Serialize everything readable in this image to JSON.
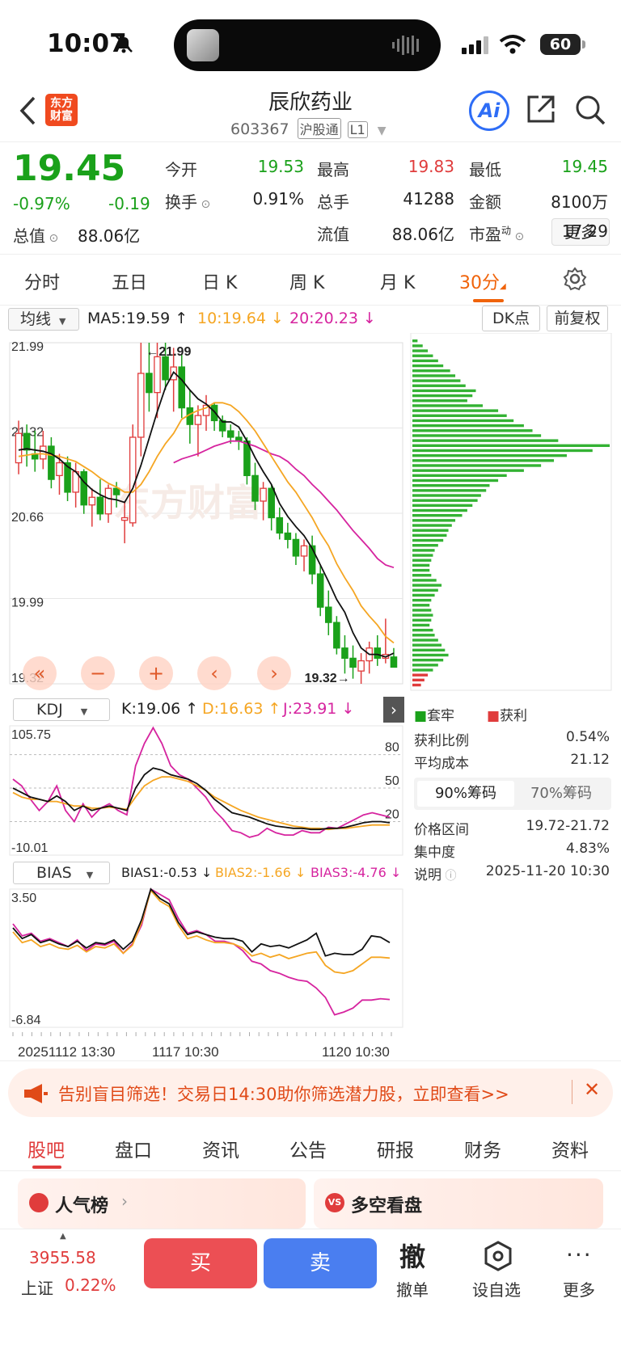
{
  "status": {
    "time": "10:07",
    "battery": "60"
  },
  "header": {
    "title": "辰欣药业",
    "code": "603367",
    "tag1": "沪股通",
    "tag2": "L1",
    "logo_line1": "东方",
    "logo_line2": "财富",
    "ai_label": "Ai"
  },
  "quote": {
    "price": "19.45",
    "change_pct": "-0.97%",
    "change": "-0.19",
    "rows": [
      [
        {
          "label": "今开",
          "value": "19.53",
          "color": "green"
        },
        {
          "label": "最高",
          "value": "19.83",
          "color": "red"
        },
        {
          "label": "最低",
          "value": "19.45",
          "color": "green"
        }
      ],
      [
        {
          "label": "换手",
          "value": "0.91%",
          "color": "none"
        },
        {
          "label": "总手",
          "value": "41288",
          "color": "none"
        },
        {
          "label": "金额",
          "value": "8100万",
          "color": "none"
        }
      ],
      [
        {
          "label": "流值",
          "value": "88.06亿",
          "color": "none"
        },
        {
          "label": "市盈",
          "value": "17.29",
          "color": "none"
        }
      ]
    ],
    "total_label": "总值",
    "total_value": "88.06亿",
    "pe_sup": "动",
    "more_label": "更多"
  },
  "tabs": [
    "分时",
    "五日",
    "日 K",
    "周 K",
    "月 K",
    "30分"
  ],
  "active_tab": "30分",
  "kchart": {
    "ma_select": "均线",
    "ma5": "MA5:19.59",
    "ma10": "10:19.64",
    "ma20": "20:20.23",
    "dk_label": "DK点",
    "adjust_label": "前复权",
    "price_ticks": [
      "21.99",
      "21.32",
      "20.66",
      "19.99",
      "19.32"
    ],
    "high_label": "21.99",
    "low_label": "19.32",
    "watermark": "东方财富",
    "colors": {
      "up": "#e03c3c",
      "down": "#1aa11a",
      "ma5": "#111111",
      "ma10": "#f5a623",
      "ma20": "#d6249f"
    }
  },
  "chart_data": {
    "type": "candlestick",
    "interval": "30分",
    "candles": [
      {
        "o": 21.05,
        "h": 21.38,
        "l": 20.96,
        "c": 21.28
      },
      {
        "o": 21.28,
        "h": 21.35,
        "l": 21.02,
        "c": 21.15
      },
      {
        "o": 21.12,
        "h": 21.3,
        "l": 20.98,
        "c": 21.08
      },
      {
        "o": 21.08,
        "h": 21.3,
        "l": 21.0,
        "c": 21.18
      },
      {
        "o": 21.18,
        "h": 21.25,
        "l": 20.85,
        "c": 20.92
      },
      {
        "o": 20.95,
        "h": 21.12,
        "l": 20.8,
        "c": 21.05
      },
      {
        "o": 21.05,
        "h": 21.1,
        "l": 20.75,
        "c": 20.82
      },
      {
        "o": 20.82,
        "h": 21.05,
        "l": 20.7,
        "c": 20.98
      },
      {
        "o": 20.98,
        "h": 21.0,
        "l": 20.65,
        "c": 20.72
      },
      {
        "o": 20.72,
        "h": 20.85,
        "l": 20.55,
        "c": 20.78
      },
      {
        "o": 20.78,
        "h": 20.92,
        "l": 20.6,
        "c": 20.65
      },
      {
        "o": 20.65,
        "h": 20.88,
        "l": 20.58,
        "c": 20.85
      },
      {
        "o": 20.85,
        "h": 20.9,
        "l": 20.7,
        "c": 20.8
      },
      {
        "o": 20.6,
        "h": 20.75,
        "l": 20.42,
        "c": 20.62
      },
      {
        "o": 20.58,
        "h": 21.35,
        "l": 20.55,
        "c": 21.25
      },
      {
        "o": 21.25,
        "h": 21.99,
        "l": 21.1,
        "c": 21.75
      },
      {
        "o": 21.75,
        "h": 21.99,
        "l": 21.45,
        "c": 21.6
      },
      {
        "o": 21.6,
        "h": 21.99,
        "l": 21.4,
        "c": 21.88
      },
      {
        "o": 21.88,
        "h": 21.99,
        "l": 21.62,
        "c": 21.7
      },
      {
        "o": 21.7,
        "h": 21.95,
        "l": 21.45,
        "c": 21.8
      },
      {
        "o": 21.8,
        "h": 21.9,
        "l": 21.4,
        "c": 21.48
      },
      {
        "o": 21.48,
        "h": 21.62,
        "l": 21.2,
        "c": 21.35
      },
      {
        "o": 21.35,
        "h": 21.5,
        "l": 21.1,
        "c": 21.42
      },
      {
        "o": 21.42,
        "h": 21.58,
        "l": 21.3,
        "c": 21.5
      },
      {
        "o": 21.5,
        "h": 21.52,
        "l": 21.3,
        "c": 21.38
      },
      {
        "o": 21.38,
        "h": 21.42,
        "l": 21.25,
        "c": 21.3
      },
      {
        "o": 21.3,
        "h": 21.35,
        "l": 21.2,
        "c": 21.25
      },
      {
        "o": 21.25,
        "h": 21.3,
        "l": 21.15,
        "c": 21.22
      },
      {
        "o": 21.22,
        "h": 21.25,
        "l": 20.88,
        "c": 20.95
      },
      {
        "o": 20.95,
        "h": 21.05,
        "l": 20.68,
        "c": 20.75
      },
      {
        "o": 20.75,
        "h": 20.9,
        "l": 20.6,
        "c": 20.85
      },
      {
        "o": 20.85,
        "h": 20.88,
        "l": 20.52,
        "c": 20.62
      },
      {
        "o": 20.62,
        "h": 20.7,
        "l": 20.45,
        "c": 20.5
      },
      {
        "o": 20.5,
        "h": 20.58,
        "l": 20.38,
        "c": 20.45
      },
      {
        "o": 20.45,
        "h": 20.5,
        "l": 20.25,
        "c": 20.32
      },
      {
        "o": 20.32,
        "h": 20.45,
        "l": 20.2,
        "c": 20.4
      },
      {
        "o": 20.4,
        "h": 20.48,
        "l": 20.1,
        "c": 20.18
      },
      {
        "o": 20.18,
        "h": 20.25,
        "l": 19.85,
        "c": 19.92
      },
      {
        "o": 19.92,
        "h": 20.05,
        "l": 19.7,
        "c": 19.8
      },
      {
        "o": 19.8,
        "h": 19.85,
        "l": 19.55,
        "c": 19.6
      },
      {
        "o": 19.6,
        "h": 19.7,
        "l": 19.4,
        "c": 19.52
      },
      {
        "o": 19.52,
        "h": 19.62,
        "l": 19.36,
        "c": 19.45
      },
      {
        "o": 19.42,
        "h": 19.56,
        "l": 19.32,
        "c": 19.5
      },
      {
        "o": 19.5,
        "h": 19.65,
        "l": 19.4,
        "c": 19.6
      },
      {
        "o": 19.6,
        "h": 19.7,
        "l": 19.46,
        "c": 19.52
      },
      {
        "o": 19.52,
        "h": 19.83,
        "l": 19.48,
        "c": 19.55
      },
      {
        "o": 19.53,
        "h": 19.6,
        "l": 19.45,
        "c": 19.45
      }
    ],
    "ma5": [
      21.15,
      21.16,
      21.15,
      21.14,
      21.12,
      21.08,
      21.02,
      20.98,
      20.9,
      20.84,
      20.8,
      20.77,
      20.76,
      20.74,
      20.85,
      21.03,
      21.24,
      21.45,
      21.64,
      21.76,
      21.7,
      21.62,
      21.55,
      21.51,
      21.45,
      21.37,
      21.37,
      21.33,
      21.22,
      21.09,
      20.98,
      20.88,
      20.73,
      20.63,
      20.55,
      20.48,
      20.38,
      20.25,
      20.12,
      19.98,
      19.88,
      19.72,
      19.6,
      19.55,
      19.55,
      19.53,
      19.56
    ],
    "ma10": [
      21.1,
      21.11,
      21.12,
      21.12,
      21.11,
      21.1,
      21.08,
      21.06,
      21.02,
      20.98,
      20.93,
      20.89,
      20.86,
      20.82,
      20.82,
      20.88,
      20.98,
      21.1,
      21.2,
      21.28,
      21.39,
      21.43,
      21.46,
      21.48,
      21.52,
      21.52,
      21.5,
      21.45,
      21.38,
      21.3,
      21.2,
      21.1,
      21.0,
      20.9,
      20.82,
      20.72,
      20.62,
      20.5,
      20.4,
      20.26,
      20.15,
      20.05,
      19.93,
      19.85,
      19.78,
      19.69,
      19.64
    ],
    "ma20": [
      null,
      null,
      null,
      null,
      null,
      null,
      null,
      null,
      null,
      null,
      null,
      null,
      null,
      null,
      null,
      null,
      null,
      null,
      null,
      21.05,
      21.08,
      21.1,
      21.12,
      21.15,
      21.18,
      21.2,
      21.22,
      21.22,
      21.2,
      21.18,
      21.15,
      21.12,
      21.1,
      21.06,
      21.0,
      20.95,
      20.88,
      20.82,
      20.75,
      20.68,
      20.6,
      20.52,
      20.45,
      20.38,
      20.3,
      20.25,
      20.23
    ],
    "price_range": [
      19.32,
      21.99
    ],
    "x_labels": [
      "20251112 13:30",
      "1117 10:30",
      "1120 10:30"
    ]
  },
  "kdj": {
    "select": "KDJ",
    "k": "K:19.06",
    "d": "D:16.63",
    "j": "J:23.91",
    "ticks_left": [
      "105.75",
      "-10.01"
    ],
    "ticks_right": [
      "80",
      "50",
      "20"
    ],
    "range": [
      -10.01,
      105.75
    ],
    "k_series": [
      50,
      46,
      42,
      40,
      38,
      43,
      38,
      30,
      34,
      30,
      32,
      34,
      32,
      30,
      50,
      62,
      68,
      66,
      62,
      60,
      58,
      54,
      48,
      40,
      34,
      28,
      26,
      24,
      21,
      18,
      16,
      15,
      14,
      14,
      13,
      13,
      14,
      14,
      15,
      17,
      19,
      20,
      20,
      19
    ],
    "d_series": [
      46,
      42,
      40,
      40,
      38,
      38,
      36,
      34,
      34,
      32,
      32,
      33,
      32,
      31,
      42,
      52,
      57,
      60,
      60,
      58,
      56,
      52,
      48,
      42,
      38,
      34,
      30,
      27,
      24,
      22,
      20,
      18,
      16,
      15,
      14,
      14,
      13,
      14,
      14,
      15,
      16,
      17,
      17,
      17
    ],
    "j_series": [
      58,
      52,
      40,
      30,
      38,
      52,
      30,
      20,
      36,
      24,
      32,
      36,
      30,
      26,
      70,
      90,
      104,
      90,
      70,
      62,
      58,
      50,
      42,
      30,
      22,
      12,
      10,
      6,
      8,
      14,
      10,
      8,
      8,
      12,
      10,
      10,
      15,
      14,
      18,
      22,
      26,
      28,
      26,
      24
    ]
  },
  "bias": {
    "select": "BIAS",
    "b1": "BIAS1:-0.53",
    "b2": "BIAS2:-1.66",
    "b3": "BIAS3:-4.76",
    "ticks": [
      "3.50",
      "-6.84"
    ],
    "range": [
      -6.84,
      3.5
    ],
    "b1_series": [
      0.6,
      -0.2,
      0.1,
      -0.5,
      -0.3,
      -0.6,
      -0.8,
      -0.4,
      -0.9,
      -0.5,
      -0.6,
      -0.3,
      -1.0,
      -0.4,
      1.2,
      3.5,
      2.8,
      2.4,
      1.0,
      0.1,
      0.3,
      0.1,
      -0.1,
      -0.2,
      -0.2,
      -0.4,
      -1.2,
      -0.6,
      -0.8,
      -0.7,
      -0.9,
      -0.6,
      -0.3,
      0.2,
      -1.5,
      -1.3,
      -1.4,
      -1.4,
      -1.0,
      0.0,
      -0.1,
      -0.5
    ],
    "b2_series": [
      0.3,
      -0.5,
      -0.3,
      -0.8,
      -0.6,
      -0.9,
      -1.0,
      -0.7,
      -1.2,
      -0.8,
      -0.9,
      -0.6,
      -1.3,
      -0.7,
      1.0,
      3.4,
      2.6,
      2.2,
      0.8,
      -0.2,
      0.0,
      -0.3,
      -0.5,
      -0.5,
      -0.6,
      -0.9,
      -1.5,
      -1.3,
      -1.6,
      -1.4,
      -1.7,
      -1.5,
      -1.3,
      -1.2,
      -2.2,
      -2.7,
      -2.8,
      -2.6,
      -2.1,
      -1.6,
      -1.6,
      -1.66
    ],
    "b3_series": [
      0.9,
      0.0,
      0.2,
      -0.4,
      -0.2,
      -0.5,
      -0.8,
      -0.3,
      -1.1,
      -0.6,
      -0.7,
      -0.4,
      -1.3,
      -0.6,
      0.8,
      3.5,
      3.1,
      2.7,
      1.3,
      0.2,
      0.4,
      0.1,
      -0.4,
      -0.4,
      -0.6,
      -1.1,
      -1.9,
      -2.1,
      -2.6,
      -2.8,
      -3.1,
      -3.3,
      -3.4,
      -3.9,
      -4.6,
      -5.9,
      -5.7,
      -5.4,
      -4.8,
      -4.8,
      -4.7,
      -4.76
    ]
  },
  "chips": {
    "legend_trapped": "套牢",
    "legend_profit": "获利",
    "rows": [
      {
        "label": "获利比例",
        "value": "0.54%"
      },
      {
        "label": "平均成本",
        "value": "21.12"
      }
    ],
    "tab_90": "90%筹码",
    "tab_70": "70%筹码",
    "rows2": [
      {
        "label": "价格区间",
        "value": "19.72-21.72"
      },
      {
        "label": "集中度",
        "value": "4.83%"
      },
      {
        "label": "说明",
        "value": "2025-11-20 10:30"
      }
    ],
    "profile": [
      6,
      12,
      18,
      24,
      30,
      36,
      44,
      50,
      56,
      62,
      74,
      70,
      64,
      82,
      100,
      110,
      118,
      130,
      140,
      150,
      170,
      230,
      210,
      180,
      165,
      150,
      130,
      110,
      100,
      90,
      86,
      80,
      76,
      70,
      64,
      58,
      50,
      46,
      42,
      40,
      36,
      30,
      26,
      24,
      22,
      20,
      20,
      22,
      28,
      34,
      30,
      26,
      22,
      20,
      22,
      24,
      22,
      20,
      24,
      26,
      30,
      34,
      38,
      42,
      36,
      30,
      24,
      18,
      14,
      10
    ]
  },
  "controls": [
    "«",
    "−",
    "+",
    "‹",
    "›"
  ],
  "banner": {
    "text": "告别盲目筛选！交易日14:30助你筛选潜力股，立即查看>>"
  },
  "subtabs": [
    "股吧",
    "盘口",
    "资讯",
    "公告",
    "研报",
    "财务",
    "资料"
  ],
  "active_subtab": "股吧",
  "cards": {
    "left": "人气榜",
    "right": "多空看盘"
  },
  "bottom": {
    "index_value": "3955.58",
    "index_name": "上证",
    "index_pct": "0.22%",
    "buy": "买",
    "sell": "卖",
    "cancel_icon": "撤",
    "cancel_label": "撤单",
    "self_label": "设自选",
    "more_label": "更多"
  }
}
